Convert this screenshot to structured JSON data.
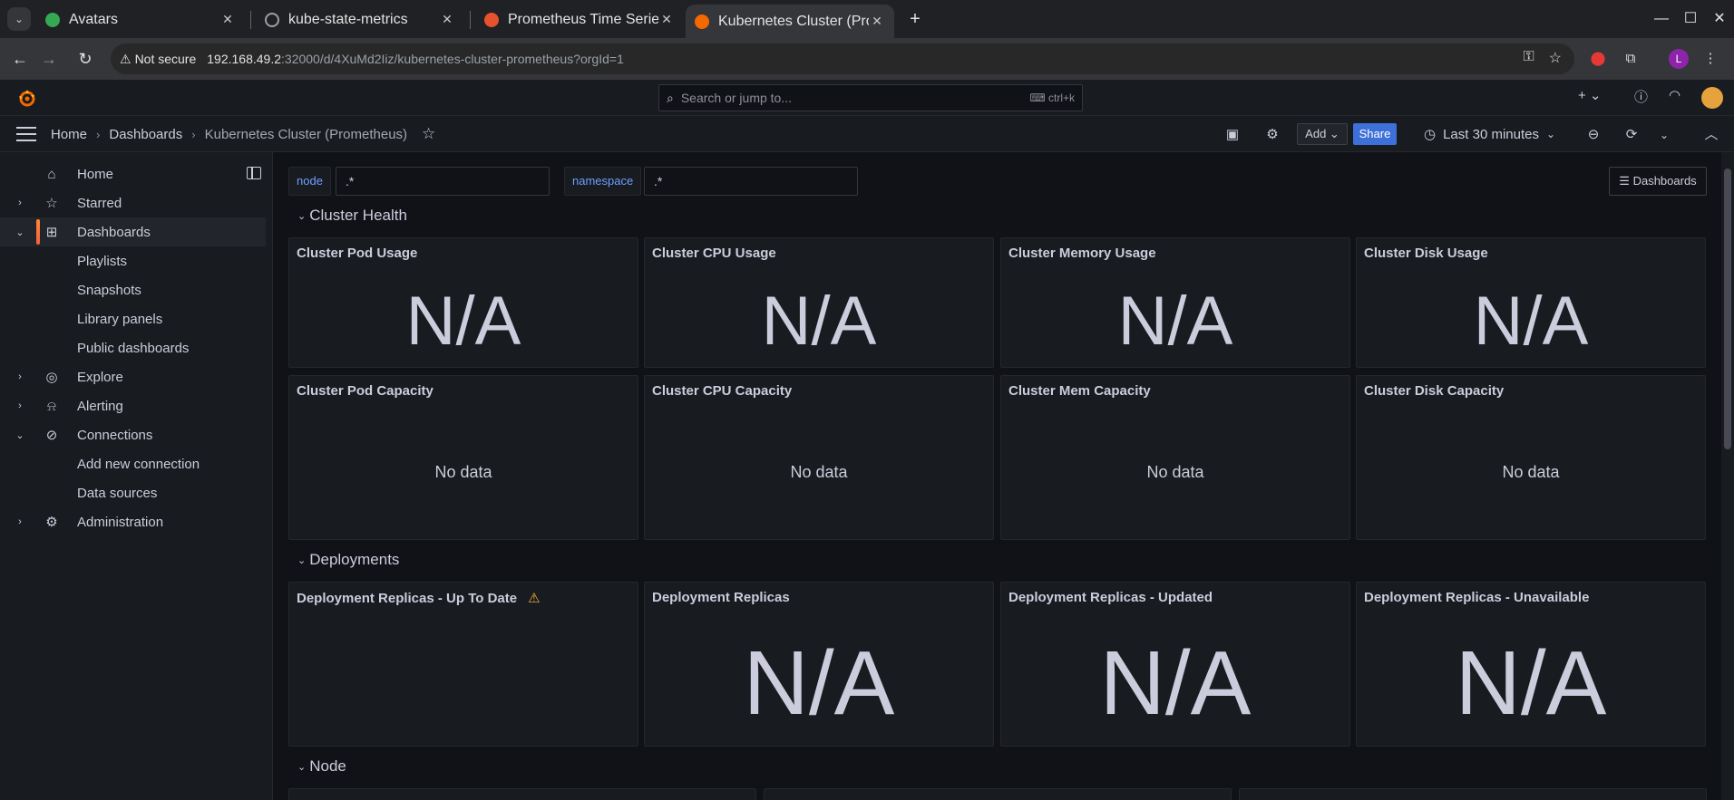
{
  "browser": {
    "tabs": [
      {
        "label": "Avatars",
        "favicon_color": "#34a853"
      },
      {
        "label": "kube-state-metrics",
        "favicon_color": "#9aa0a6"
      },
      {
        "label": "Prometheus Time Series",
        "favicon_color": "#e6522c"
      },
      {
        "label": "Kubernetes Cluster (Prom",
        "favicon_color": "#f46800"
      }
    ],
    "security_label": "Not secure",
    "url_host": "192.168.49.2",
    "url_rest": ":32000/d/4XuMd2Iiz/kubernetes-cluster-prometheus?orgId=1",
    "profile_initial": "L"
  },
  "topbar": {
    "search_placeholder": "Search or jump to...",
    "search_shortcut": "ctrl+k"
  },
  "breadcrumb": {
    "home": "Home",
    "dashboards": "Dashboards",
    "current": "Kubernetes Cluster (Prometheus)"
  },
  "toolbar": {
    "add_label": "Add",
    "share_label": "Share",
    "time_range": "Last 30 minutes"
  },
  "sidebar": {
    "items": [
      {
        "label": "Home",
        "icon": "home-icon"
      },
      {
        "label": "Starred",
        "icon": "star-icon"
      },
      {
        "label": "Dashboards",
        "icon": "apps-icon"
      },
      {
        "label": "Playlists"
      },
      {
        "label": "Snapshots"
      },
      {
        "label": "Library panels"
      },
      {
        "label": "Public dashboards"
      },
      {
        "label": "Explore",
        "icon": "compass-icon"
      },
      {
        "label": "Alerting",
        "icon": "bell-icon"
      },
      {
        "label": "Connections",
        "icon": "link-icon"
      },
      {
        "label": "Add new connection"
      },
      {
        "label": "Data sources"
      },
      {
        "label": "Administration",
        "icon": "cog-icon"
      }
    ]
  },
  "variables": [
    {
      "label": "node",
      "value": ".*"
    },
    {
      "label": "namespace",
      "value": ".*"
    }
  ],
  "dashboards_button": "Dashboards",
  "rows": [
    {
      "title": "Cluster Health"
    },
    {
      "title": "Deployments"
    },
    {
      "title": "Node"
    }
  ],
  "panels": {
    "health_usage": [
      {
        "title": "Cluster Pod Usage",
        "value": "N/A"
      },
      {
        "title": "Cluster CPU Usage",
        "value": "N/A"
      },
      {
        "title": "Cluster Memory Usage",
        "value": "N/A"
      },
      {
        "title": "Cluster Disk Usage",
        "value": "N/A"
      }
    ],
    "health_capacity": [
      {
        "title": "Cluster Pod Capacity",
        "value": "No data"
      },
      {
        "title": "Cluster CPU Capacity",
        "value": "No data"
      },
      {
        "title": "Cluster Mem Capacity",
        "value": "No data"
      },
      {
        "title": "Cluster Disk Capacity",
        "value": "No data"
      }
    ],
    "deployments": [
      {
        "title": "Deployment Replicas - Up To Date",
        "value": ""
      },
      {
        "title": "Deployment Replicas",
        "value": "N/A"
      },
      {
        "title": "Deployment Replicas - Updated",
        "value": "N/A"
      },
      {
        "title": "Deployment Replicas - Unavailable",
        "value": "N/A"
      }
    ]
  },
  "colors": {
    "accent_blue": "#3d71d9",
    "variable_label": "#6e9fff",
    "warning": "#f5b73d",
    "active_nav_bar": "#f55f3e"
  }
}
